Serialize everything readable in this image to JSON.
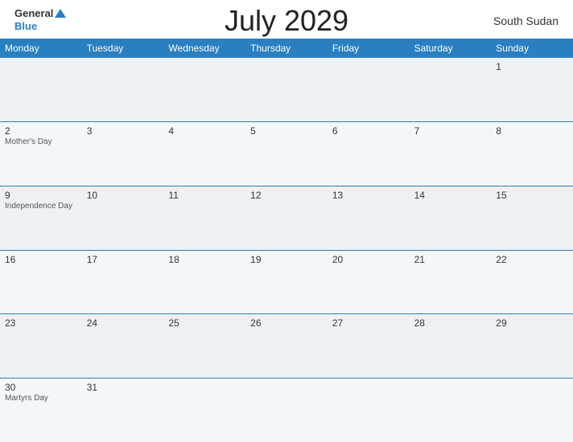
{
  "header": {
    "title": "July 2029",
    "country": "South Sudan",
    "logo_general": "General",
    "logo_blue": "Blue"
  },
  "days_of_week": [
    "Monday",
    "Tuesday",
    "Wednesday",
    "Thursday",
    "Friday",
    "Saturday",
    "Sunday"
  ],
  "weeks": [
    [
      {
        "day": "",
        "event": ""
      },
      {
        "day": "",
        "event": ""
      },
      {
        "day": "",
        "event": ""
      },
      {
        "day": "",
        "event": ""
      },
      {
        "day": "",
        "event": ""
      },
      {
        "day": "",
        "event": ""
      },
      {
        "day": "1",
        "event": ""
      }
    ],
    [
      {
        "day": "2",
        "event": "Mother's Day"
      },
      {
        "day": "3",
        "event": ""
      },
      {
        "day": "4",
        "event": ""
      },
      {
        "day": "5",
        "event": ""
      },
      {
        "day": "6",
        "event": ""
      },
      {
        "day": "7",
        "event": ""
      },
      {
        "day": "8",
        "event": ""
      }
    ],
    [
      {
        "day": "9",
        "event": "Independence Day"
      },
      {
        "day": "10",
        "event": ""
      },
      {
        "day": "11",
        "event": ""
      },
      {
        "day": "12",
        "event": ""
      },
      {
        "day": "13",
        "event": ""
      },
      {
        "day": "14",
        "event": ""
      },
      {
        "day": "15",
        "event": ""
      }
    ],
    [
      {
        "day": "16",
        "event": ""
      },
      {
        "day": "17",
        "event": ""
      },
      {
        "day": "18",
        "event": ""
      },
      {
        "day": "19",
        "event": ""
      },
      {
        "day": "20",
        "event": ""
      },
      {
        "day": "21",
        "event": ""
      },
      {
        "day": "22",
        "event": ""
      }
    ],
    [
      {
        "day": "23",
        "event": ""
      },
      {
        "day": "24",
        "event": ""
      },
      {
        "day": "25",
        "event": ""
      },
      {
        "day": "26",
        "event": ""
      },
      {
        "day": "27",
        "event": ""
      },
      {
        "day": "28",
        "event": ""
      },
      {
        "day": "29",
        "event": ""
      }
    ],
    [
      {
        "day": "30",
        "event": "Martyrs Day"
      },
      {
        "day": "31",
        "event": ""
      },
      {
        "day": "",
        "event": ""
      },
      {
        "day": "",
        "event": ""
      },
      {
        "day": "",
        "event": ""
      },
      {
        "day": "",
        "event": ""
      },
      {
        "day": "",
        "event": ""
      }
    ]
  ]
}
